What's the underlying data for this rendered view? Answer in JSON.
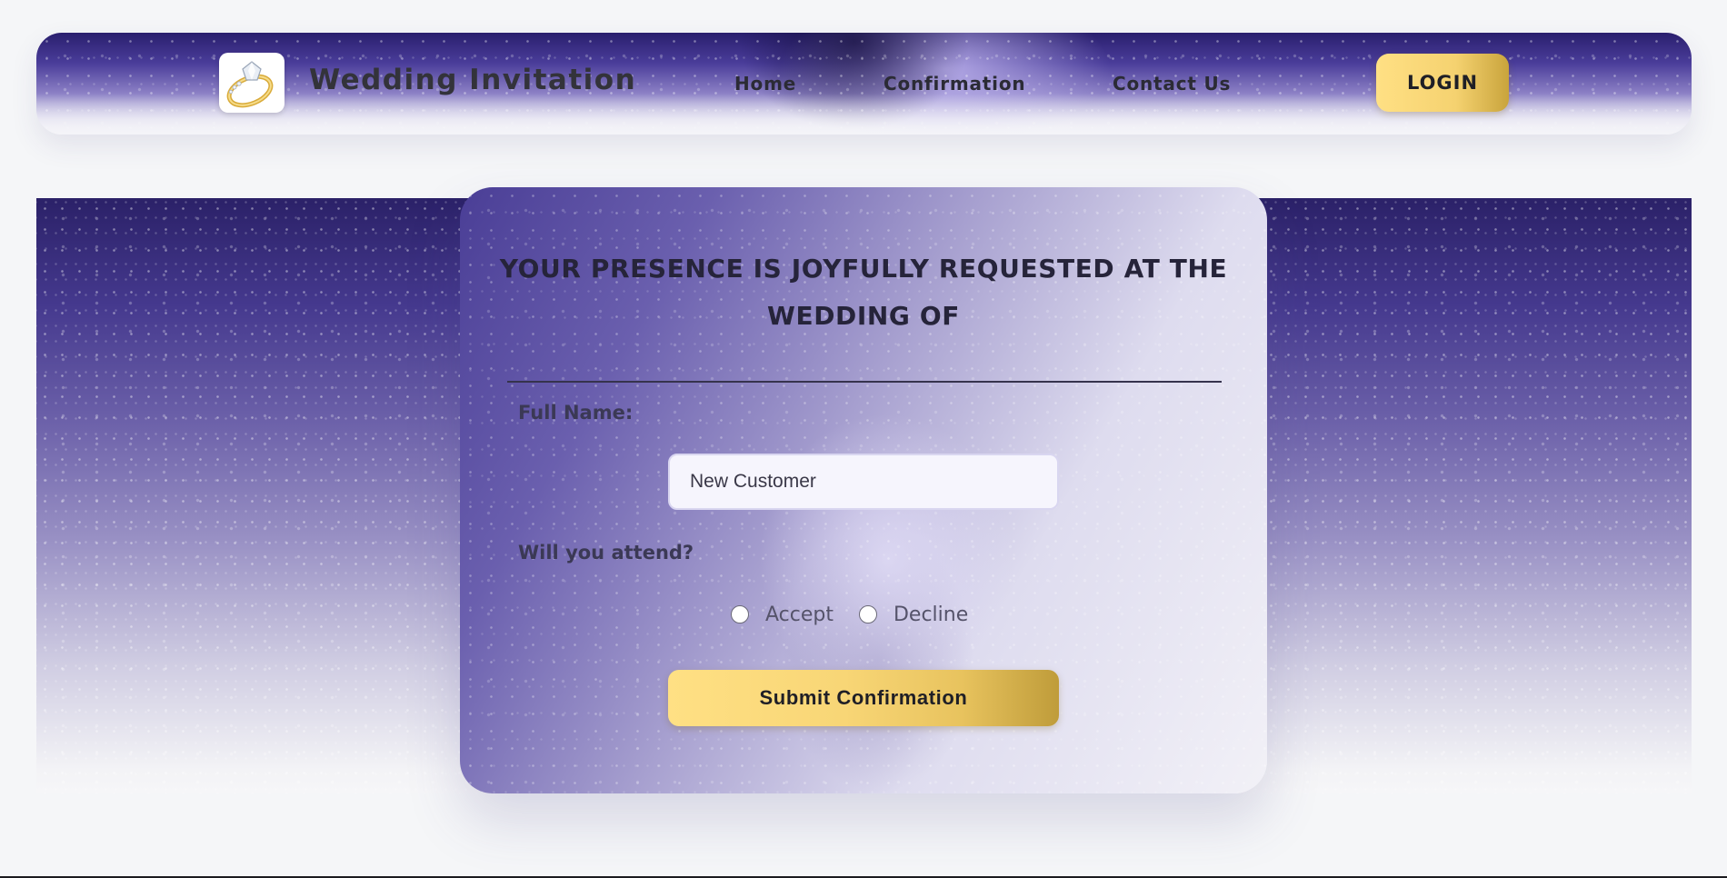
{
  "header": {
    "brand_title": "Wedding Invitation",
    "nav": {
      "home": "Home",
      "confirmation": "Confirmation",
      "contact": "Contact Us"
    },
    "login_label": "LOGIN"
  },
  "form": {
    "heading": "YOUR PRESENCE IS JOYFULLY REQUESTED AT THE WEDDING OF",
    "full_name_label": "Full Name:",
    "full_name_value": "New Customer",
    "attend_label": "Will you attend?",
    "options": {
      "accept": "Accept",
      "decline": "Decline"
    },
    "submit_label": "Submit Confirmation"
  },
  "colors": {
    "accent_gold": "#f5d270",
    "background_purple": "#45398e",
    "text_dark": "#2b2b35"
  },
  "icons": {
    "logo": "diamond-ring-icon"
  }
}
